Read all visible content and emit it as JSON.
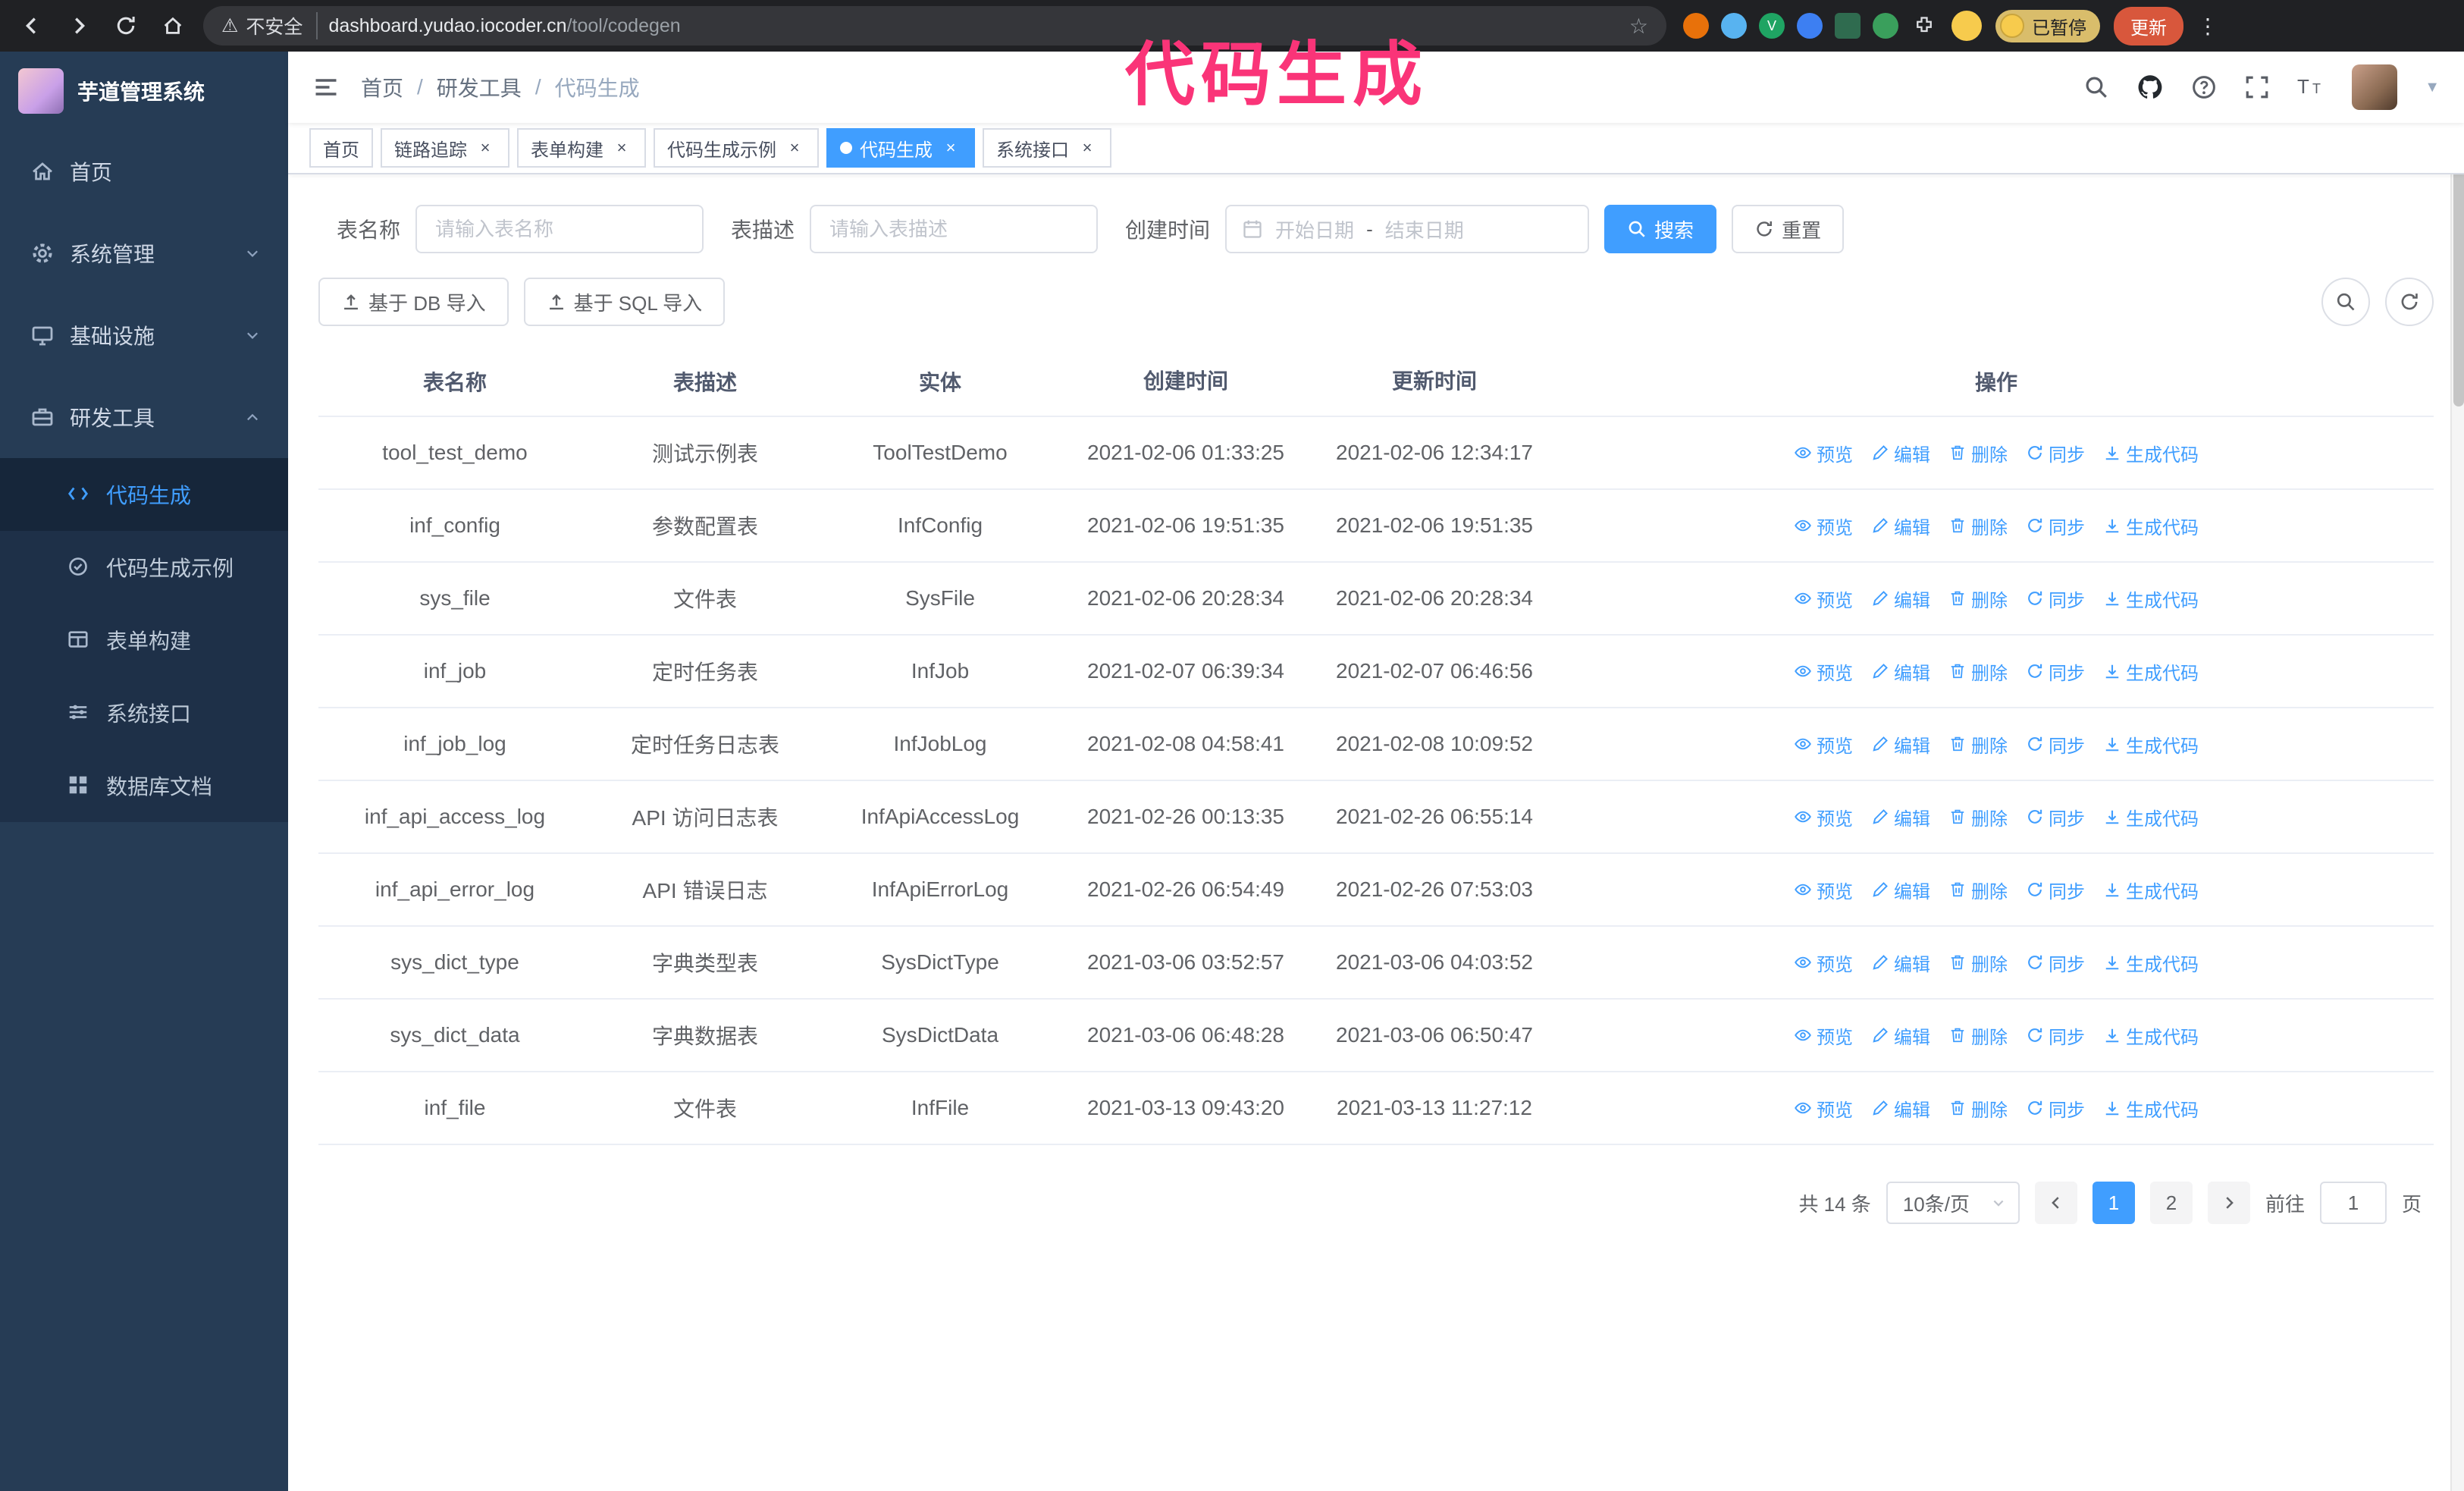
{
  "colors": {
    "accent": "#409eff",
    "annotation": "#fa3478",
    "update": "#d8573c"
  },
  "annotation": "代码生成",
  "browser": {
    "security_label": "不安全",
    "url_host": "dashboard.yudao.iocoder.cn",
    "url_path": "/tool/codegen",
    "paused_badge": "已暂停",
    "update_button": "更新"
  },
  "sidebar": {
    "app_title": "芋道管理系统",
    "items": [
      {
        "label": "首页"
      },
      {
        "label": "系统管理"
      },
      {
        "label": "基础设施"
      },
      {
        "label": "研发工具"
      }
    ],
    "subitems": [
      {
        "label": "代码生成"
      },
      {
        "label": "代码生成示例"
      },
      {
        "label": "表单构建"
      },
      {
        "label": "系统接口"
      },
      {
        "label": "数据库文档"
      }
    ]
  },
  "breadcrumb": [
    "首页",
    "研发工具",
    "代码生成"
  ],
  "tabs": [
    {
      "label": "首页"
    },
    {
      "label": "链路追踪"
    },
    {
      "label": "表单构建"
    },
    {
      "label": "代码生成示例"
    },
    {
      "label": "代码生成"
    },
    {
      "label": "系统接口"
    }
  ],
  "filters": {
    "table_name_label": "表名称",
    "table_name_placeholder": "请输入表名称",
    "table_desc_label": "表描述",
    "table_desc_placeholder": "请输入表描述",
    "create_time_label": "创建时间",
    "date_start_placeholder": "开始日期",
    "date_separator": "-",
    "date_end_placeholder": "结束日期",
    "search_button": "搜索",
    "reset_button": "重置"
  },
  "toolbar": {
    "import_db": "基于 DB 导入",
    "import_sql": "基于 SQL 导入"
  },
  "table": {
    "columns": [
      "表名称",
      "表描述",
      "实体",
      "创建时间",
      "更新时间",
      "操作"
    ],
    "actions": [
      "预览",
      "编辑",
      "删除",
      "同步",
      "生成代码"
    ],
    "rows": [
      {
        "name": "tool_test_demo",
        "desc": "测试示例表",
        "entity": "ToolTestDemo",
        "created": "2021-02-06 01:33:25",
        "updated": "2021-02-06 12:34:17"
      },
      {
        "name": "inf_config",
        "desc": "参数配置表",
        "entity": "InfConfig",
        "created": "2021-02-06 19:51:35",
        "updated": "2021-02-06 19:51:35"
      },
      {
        "name": "sys_file",
        "desc": "文件表",
        "entity": "SysFile",
        "created": "2021-02-06 20:28:34",
        "updated": "2021-02-06 20:28:34"
      },
      {
        "name": "inf_job",
        "desc": "定时任务表",
        "entity": "InfJob",
        "created": "2021-02-07 06:39:34",
        "updated": "2021-02-07 06:46:56"
      },
      {
        "name": "inf_job_log",
        "desc": "定时任务日志表",
        "entity": "InfJobLog",
        "created": "2021-02-08 04:58:41",
        "updated": "2021-02-08 10:09:52"
      },
      {
        "name": "inf_api_access_log",
        "desc": "API 访问日志表",
        "entity": "InfApiAccessLog",
        "created": "2021-02-26 00:13:35",
        "updated": "2021-02-26 06:55:14"
      },
      {
        "name": "inf_api_error_log",
        "desc": "API 错误日志",
        "entity": "InfApiErrorLog",
        "created": "2021-02-26 06:54:49",
        "updated": "2021-02-26 07:53:03"
      },
      {
        "name": "sys_dict_type",
        "desc": "字典类型表",
        "entity": "SysDictType",
        "created": "2021-03-06 03:52:57",
        "updated": "2021-03-06 04:03:52"
      },
      {
        "name": "sys_dict_data",
        "desc": "字典数据表",
        "entity": "SysDictData",
        "created": "2021-03-06 06:48:28",
        "updated": "2021-03-06 06:50:47"
      },
      {
        "name": "inf_file",
        "desc": "文件表",
        "entity": "InfFile",
        "created": "2021-03-13 09:43:20",
        "updated": "2021-03-13 11:27:12"
      }
    ]
  },
  "pagination": {
    "total": "共 14 条",
    "page_size": "10条/页",
    "page1": "1",
    "page2": "2",
    "goto_label": "前往",
    "goto_value": "1",
    "goto_suffix": "页"
  }
}
